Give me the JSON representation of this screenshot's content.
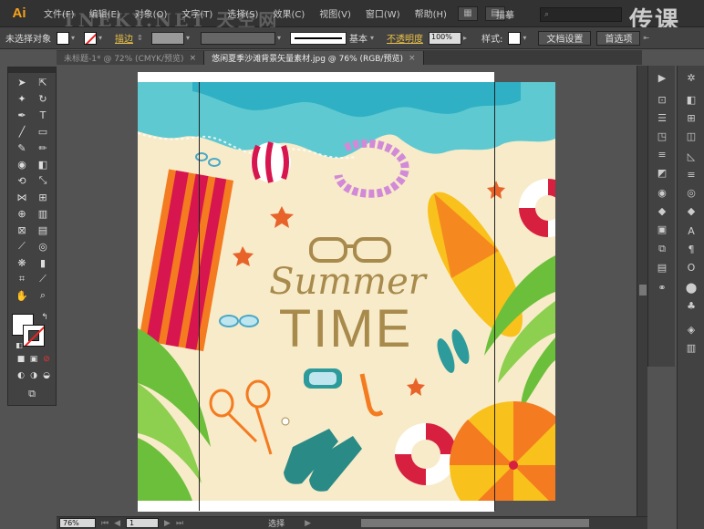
{
  "app": {
    "logo": "Ai"
  },
  "menubar": {
    "items": [
      "文件(F)",
      "编辑(E)",
      "对象(O)",
      "文字(T)",
      "选择(S)",
      "效果(C)",
      "视图(V)",
      "窗口(W)",
      "帮助(H)"
    ],
    "workspace": "描摹",
    "brand": "传课",
    "watermark": "TNEKY.NET 天空网"
  },
  "controlbar": {
    "selection_label": "未选择对象",
    "stroke_link": "描边",
    "stroke_style": "基本",
    "opacity_link": "不透明度",
    "opacity_value": "100%",
    "style_label": "样式:",
    "doc_setup_btn": "文档设置",
    "prefs_btn": "首选项",
    "fill_color": "#ffffff"
  },
  "tabs": [
    {
      "label": "未标题-1* @ 72% (CMYK/预览)",
      "active": false
    },
    {
      "label": "悠闲夏季沙滩背景矢量素材.jpg @ 76% (RGB/预览)",
      "active": true
    }
  ],
  "artwork": {
    "title_line1": "Summer",
    "title_line2": "TIME",
    "colors": {
      "sand": "#f7ebc9",
      "sea": "#5fc9d1",
      "sea_dark": "#2fb0c4",
      "text": "#a88a4c",
      "towel": "#d7154f",
      "umbrella_orange": "#f47b20",
      "umbrella_yellow": "#f9c11b",
      "palm": "#6bbf3a",
      "ring_red": "#d72040"
    }
  },
  "statusbar": {
    "zoom": "76%",
    "artboard": "1",
    "tool": "选择"
  },
  "icons": [
    "selection-tool-icon",
    "direct-selection-tool-icon",
    "pen-tool-icon",
    "type-tool-icon",
    "hand-tool-icon",
    "zoom-tool-icon",
    "search-icon",
    "close-icon"
  ]
}
